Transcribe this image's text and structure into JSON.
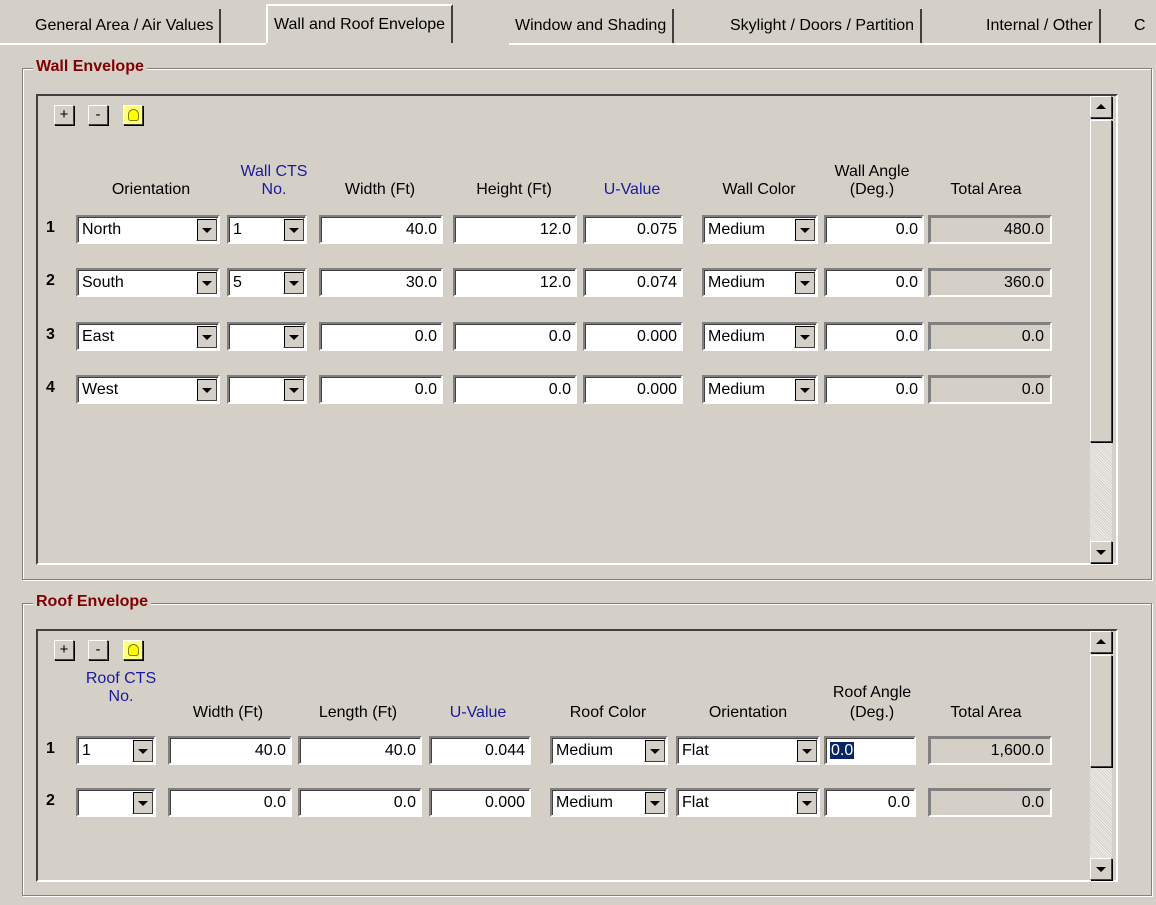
{
  "tabs": [
    {
      "label": "General Area / Air Values"
    },
    {
      "label": "Wall and Roof Envelope",
      "active": true
    },
    {
      "label": "Window and Shading"
    },
    {
      "label": "Skylight / Doors / Partition"
    },
    {
      "label": "Internal / Other"
    },
    {
      "label": "C"
    }
  ],
  "wall": {
    "title": "Wall Envelope",
    "buttons": {
      "add": "+",
      "remove": "-"
    },
    "headers": {
      "orientation": "Orientation",
      "cts_line1": "Wall CTS",
      "cts_line2": "No.",
      "width": "Width (Ft)",
      "height": "Height (Ft)",
      "uvalue": "U-Value",
      "color": "Wall Color",
      "angle_line1": "Wall Angle",
      "angle_line2": "(Deg.)",
      "total": "Total Area"
    },
    "rows": [
      {
        "num": "1",
        "orientation": "North",
        "cts": "1",
        "width": "40.0",
        "height": "12.0",
        "uvalue": "0.075",
        "color": "Medium",
        "angle": "0.0",
        "total": "480.0"
      },
      {
        "num": "2",
        "orientation": "South",
        "cts": "5",
        "width": "30.0",
        "height": "12.0",
        "uvalue": "0.074",
        "color": "Medium",
        "angle": "0.0",
        "total": "360.0"
      },
      {
        "num": "3",
        "orientation": "East",
        "cts": "",
        "width": "0.0",
        "height": "0.0",
        "uvalue": "0.000",
        "color": "Medium",
        "angle": "0.0",
        "total": "0.0"
      },
      {
        "num": "4",
        "orientation": "West",
        "cts": "",
        "width": "0.0",
        "height": "0.0",
        "uvalue": "0.000",
        "color": "Medium",
        "angle": "0.0",
        "total": "0.0"
      }
    ]
  },
  "roof": {
    "title": "Roof Envelope",
    "buttons": {
      "add": "+",
      "remove": "-"
    },
    "headers": {
      "cts_line1": "Roof CTS",
      "cts_line2": "No.",
      "width": "Width (Ft)",
      "length": "Length (Ft)",
      "uvalue": "U-Value",
      "color": "Roof Color",
      "orientation": "Orientation",
      "angle_line1": "Roof Angle",
      "angle_line2": "(Deg.)",
      "total": "Total Area"
    },
    "rows": [
      {
        "num": "1",
        "cts": "1",
        "width": "40.0",
        "length": "40.0",
        "uvalue": "0.044",
        "color": "Medium",
        "orientation": "Flat",
        "angle": "0.0",
        "total": "1,600.0"
      },
      {
        "num": "2",
        "cts": "",
        "width": "0.0",
        "length": "0.0",
        "uvalue": "0.000",
        "color": "Medium",
        "orientation": "Flat",
        "angle": "0.0",
        "total": "0.0"
      }
    ]
  }
}
